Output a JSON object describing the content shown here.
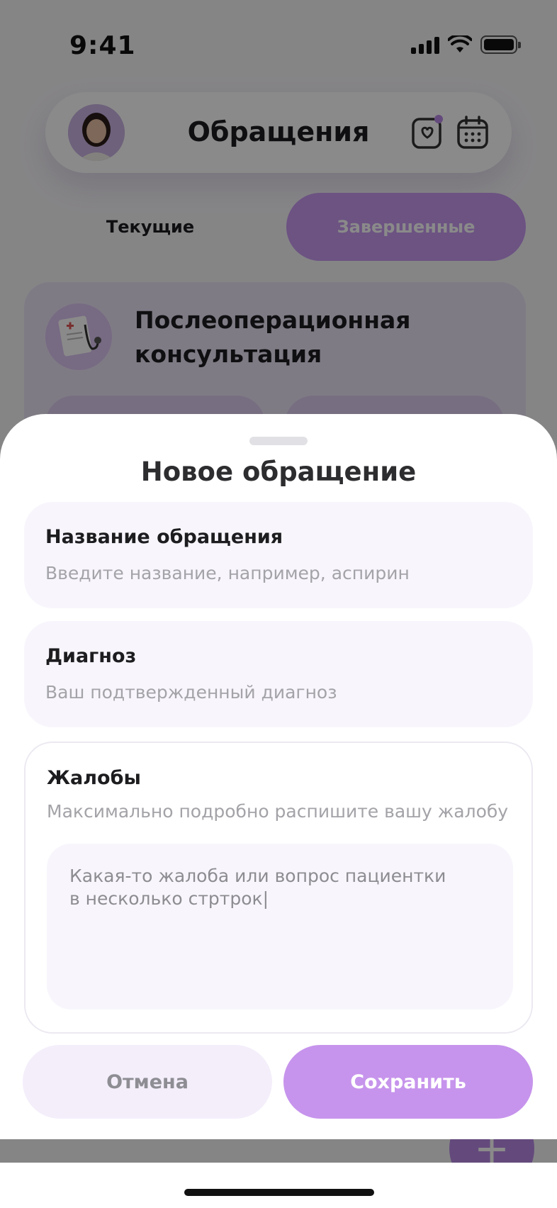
{
  "status_bar": {
    "time": "9:41"
  },
  "header": {
    "title": "Обращения"
  },
  "tabs": [
    {
      "label": "Текущие",
      "active": false
    },
    {
      "label": "Завершенные",
      "active": true
    }
  ],
  "card": {
    "title_line1": "Послеоперационная",
    "title_line2": "консультация"
  },
  "fab": {
    "label": "+"
  },
  "sheet": {
    "title": "Новое обращение",
    "name_field": {
      "label": "Название обращения",
      "placeholder": "Введите название, например, аспирин"
    },
    "diagnosis_field": {
      "label": "Диагноз",
      "placeholder": "Ваш подтвержденный диагноз"
    },
    "complaints": {
      "label": "Жалобы",
      "hint": "Максимально подробно распишите вашу жалобу",
      "value": "Какая-то жалоба или вопрос пациентки\nв несколько стртрок|"
    },
    "cancel_label": "Отмена",
    "save_label": "Сохранить"
  },
  "colors": {
    "accent": "#c694ec",
    "accent_light": "#f4eefb",
    "field_bg": "#f8f6fc"
  }
}
